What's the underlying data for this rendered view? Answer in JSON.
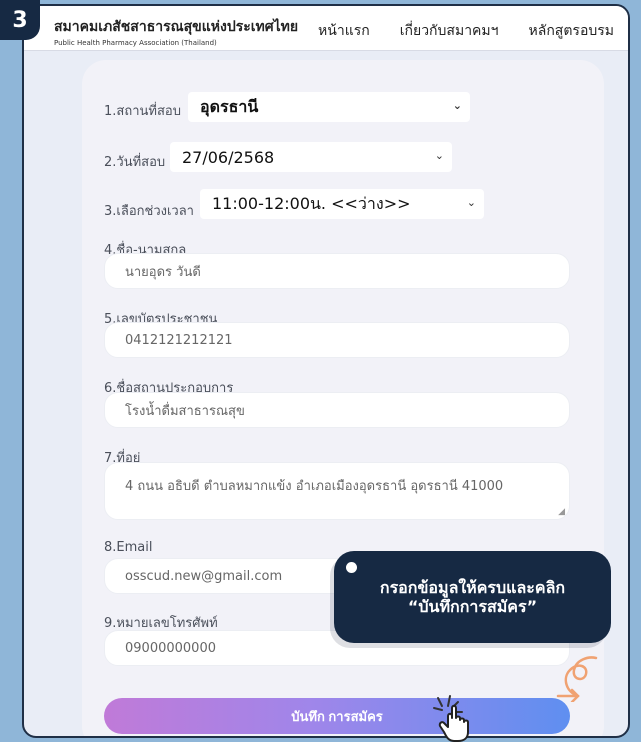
{
  "step_number": "3",
  "header": {
    "org_name": "สมาคมเภสัชสาธารณสุขแห่งประเทศไทย",
    "org_sub": "Public Health Pharmacy Association (Thailand)",
    "nav": [
      "หน้าแรก",
      "เกี่ยวกับสมาคมฯ",
      "หลักสูตรอบรม"
    ]
  },
  "form": {
    "venue_label": "1.สถานที่สอบ",
    "venue_value": "อุดรธานี",
    "date_label": "2.วันที่สอบ",
    "date_value": "27/06/2568",
    "time_label": "3.เลือกช่วงเวลา",
    "time_value": "11:00-12:00น. <<ว่าง>>",
    "name_label": "4.ชื่อ-นามสกุล",
    "name_value": "นายอุดร วันดี",
    "id_label": "5.เลขบัตรประชาชน",
    "id_value": "0412121212121",
    "business_label": "6.ชื่อสถานประกอบการ",
    "business_value": "โรงน้ำดื่มสาธารณสุข",
    "address_label": "7.ที่อยู่",
    "address_value": "4 ถนน อธิบดี ตำบลหมากแข้ง อำเภอเมืองอุดรธานี อุดรธานี 41000",
    "email_label": "8.Email",
    "email_value": "osscud.new@gmail.com",
    "phone_label": "9.หมายเลขโทรศัพท์",
    "phone_value": "09000000000",
    "submit_label": "บันทึก การสมัคร"
  },
  "callout": {
    "line1": "กรอกข้อมูลให้ครบและคลิก",
    "line2": "“บันทึกการสมัคร”"
  },
  "icons": [
    "chevron-down-icon",
    "hand-cursor-icon",
    "arrow-doodle-icon"
  ],
  "colors": {
    "background": "#8fb6d8",
    "badge": "#162943",
    "submit_start": "#c07ad8",
    "submit_end": "#5f8ff0",
    "doodle": "#f0a272"
  }
}
